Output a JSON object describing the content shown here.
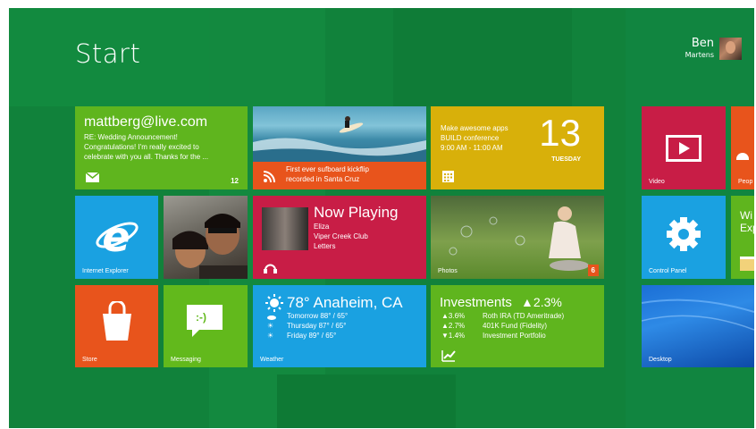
{
  "colors": {
    "background": "#11823b",
    "mail": "#5fb51e",
    "news": "#e8541c",
    "calendar": "#d8b00a",
    "music": "#c81d46",
    "ie": "#1aa1e1",
    "store": "#e8541c",
    "messaging": "#62b91c",
    "weather": "#1aa1e1",
    "finance": "#5fb51e",
    "video": "#c81d46",
    "control_panel": "#1aa1e1",
    "windows_explorer": "#5fb51e"
  },
  "start": {
    "title": "Start",
    "user": {
      "first": "Ben",
      "last": "Martens"
    }
  },
  "tiles": {
    "mail": {
      "address": "mattberg@live.com",
      "lines": [
        "RE: Wedding Announcement!",
        "Congratulations! I'm really excited to",
        "celebrate with you all. Thanks for the ..."
      ],
      "count": "12",
      "icon": "envelope-icon"
    },
    "news": {
      "caption1": "First ever sufboard kickflip",
      "caption2": "recorded in Santa Cruz",
      "icon": "rss-icon"
    },
    "calendar": {
      "line1": "Make awesome apps",
      "line2": "BUILD conference",
      "line3": "9:00 AM - 11:00 AM",
      "day": "13",
      "weekday": "TUESDAY",
      "icon": "calendar-icon"
    },
    "ie": {
      "label": "Internet Explorer",
      "icon": "internet-explorer-icon"
    },
    "people_photo": {},
    "music": {
      "title": "Now Playing",
      "artist": "Eliza",
      "album": "Viper Creek Club",
      "song": "Letters",
      "icon": "headphones-icon"
    },
    "photos": {
      "label": "Photos",
      "count": "6"
    },
    "store": {
      "label": "Store",
      "icon": "shopping-bag-icon"
    },
    "messaging": {
      "label": "Messaging",
      "emoticon": ":-)",
      "icon": "speech-bubble-icon"
    },
    "weather": {
      "current": "78° Anaheim, CA",
      "forecast": [
        "Tomorrow  88° / 65°",
        "Thursday  87° / 65°",
        "Friday  89° / 65°"
      ],
      "label": "Weather",
      "icon": "sun-icon"
    },
    "investments": {
      "title": "Investments",
      "change": "▲2.3%",
      "rows": [
        {
          "pct": "▲3.6%",
          "name": "Roth IRA (TD Ameritrade)"
        },
        {
          "pct": "▲2.7%",
          "name": "401K Fund (Fidelity)"
        },
        {
          "pct": "▼1.4%",
          "name": "Investment Portfolio"
        }
      ],
      "icon": "trend-chart-icon"
    },
    "video": {
      "label": "Video",
      "icon": "play-icon"
    },
    "people": {
      "label": "Peop"
    },
    "control_panel": {
      "label": "Control Panel",
      "icon": "gear-icon"
    },
    "windows_explorer": {
      "line1": "Wi",
      "line2": "Exp",
      "icon": "folder-icon"
    },
    "desktop": {
      "label": "Desktop"
    }
  }
}
